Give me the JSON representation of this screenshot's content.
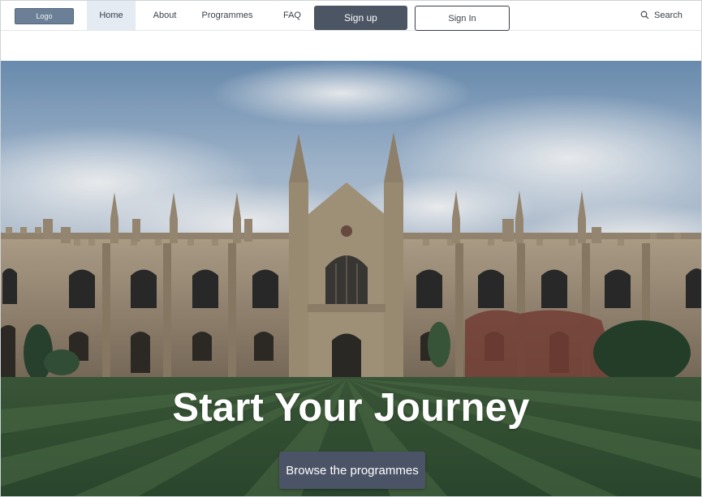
{
  "nav": {
    "logo_label": "Logo",
    "links": [
      "Home",
      "About",
      "Programmes",
      "FAQ"
    ],
    "active": "Home",
    "signup_label": "Sign up",
    "signin_label": "Sign In",
    "search_label": "Search"
  },
  "hero": {
    "title": "Start Your Journey",
    "cta_label": "Browse the programmes"
  },
  "colors": {
    "nav_active_bg": "#e5ebf3",
    "primary_button": "#4b5563",
    "cta_button": "#4b5366"
  }
}
